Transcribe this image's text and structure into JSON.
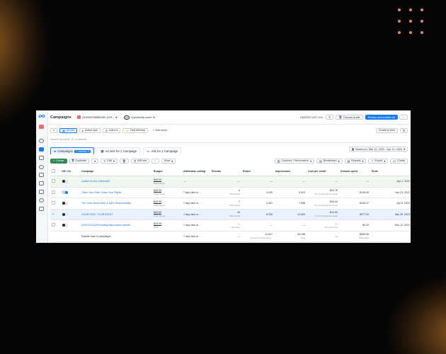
{
  "header": {
    "title": "Campaigns",
    "account": "1815269788582480 (103...",
    "opportunity": "Opportunity score",
    "opp_score": "90",
    "updated": "Updated just now",
    "discard": "Discard drafts",
    "review": "Review and publish (6)"
  },
  "filters": {
    "all_ads": "All ads",
    "active_ads": "Active ads",
    "actions": "Actions",
    "had_delivery": "Had delivery",
    "see_more": "See more",
    "create_view": "Create a view"
  },
  "search": {
    "placeholder": "Search by name, ID or metrics"
  },
  "tabs": [
    {
      "label": "Campaigns",
      "badge": "1 selected"
    },
    {
      "label": "Ad sets for 1 Campaign"
    },
    {
      "label": "Ads for 1 Campaign"
    }
  ],
  "daterange": "Maximum: Mar 12, 2022 - Apr 12, 2023",
  "toolbar": {
    "create": "Create",
    "duplicate": "Duplicate",
    "edit": "Edit",
    "ab_test": "A/B test",
    "more": "More",
    "columns": "Columns: Performance",
    "breakdown": "Breakdown",
    "reports": "Reports",
    "export": "Export",
    "charts": "Charts"
  },
  "table": {
    "headers": [
      "Off / On",
      "Campaign",
      "Budget",
      "Attribution setting",
      "Results",
      "Reach",
      "Impressions",
      "Cost per result",
      "Amount spent",
      "Ends"
    ],
    "rows": [
      {
        "name": "Justice for the Vulnerable",
        "budget": "$40.00",
        "budget_sub": "Daily Range",
        "attr": "—",
        "results": "—",
        "results_sub": "",
        "reach": "—",
        "impr": "—",
        "cpr": "—",
        "cpr_sub": "",
        "spent": "—",
        "ends": "Apr 1, 2023",
        "on": false,
        "checked": false
      },
      {
        "name": "Claim Your Ride, Claim Your Rights",
        "budget": "$40.00",
        "budget_sub": "Daily Range",
        "attr": "7-day click or ...",
        "results": "6",
        "results_sub": "Meta leads",
        "reach": "4,190",
        "impr": "5,023",
        "cpr": "$22.76",
        "cpr_sub": "Per On-Facebook Leads",
        "spent": "$136.55",
        "ends": "Apr 23, 2023",
        "on": true,
        "checked": false
      },
      {
        "name": "The Truth About Uber & Lyft's Responsibility",
        "budget": "$40.00",
        "budget_sub": "Daily Range",
        "attr": "7-day click or ...",
        "results": "7",
        "results_sub": "Meta leads",
        "reach": "4,451",
        "impr": "7,598",
        "cpr": "$16.44",
        "cpr_sub": "Per On-Facebook Leads",
        "spent": "$155.37",
        "ends": "Apr 6, 2023",
        "on": false,
        "checked": false
      },
      {
        "name": "YOUR RIDE, YOUR RIGHT",
        "budget": "$40.00",
        "budget_sub": "Daily Range",
        "attr": "7-day click or ...",
        "results": "26",
        "results_sub": "Meta leads",
        "reach": "8,936",
        "impr": "12,603",
        "cpr": "$14.52",
        "cpr_sub": "Per On-Facebook Leads",
        "spent": "$377.63",
        "ends": "Mar 29, 2023",
        "on": false,
        "checked": true
      },
      {
        "name": "[10/22/2024] Promoting https://www.oldmilk...",
        "budget": "$10.00",
        "budget_sub": "Daily",
        "attr": "7-day click or ...",
        "results": "—",
        "results_sub": "Link Click",
        "reach": "—",
        "impr": "—",
        "cpr": "—",
        "cpr_sub": "Per Link Click",
        "spent": "$0.30",
        "ends": "Nov 12, 2024",
        "on": false,
        "checked": false
      }
    ],
    "total": {
      "label": "Results from 5 campaigns",
      "attr": "7-day click or ...",
      "results": "—",
      "reach": "11,637",
      "reach_sub": "Accounts Center acco...",
      "impr": "26,156",
      "impr_sub": "Total",
      "cpr": "—",
      "spent": "$359.45",
      "spent_sub": "Total spent"
    }
  }
}
